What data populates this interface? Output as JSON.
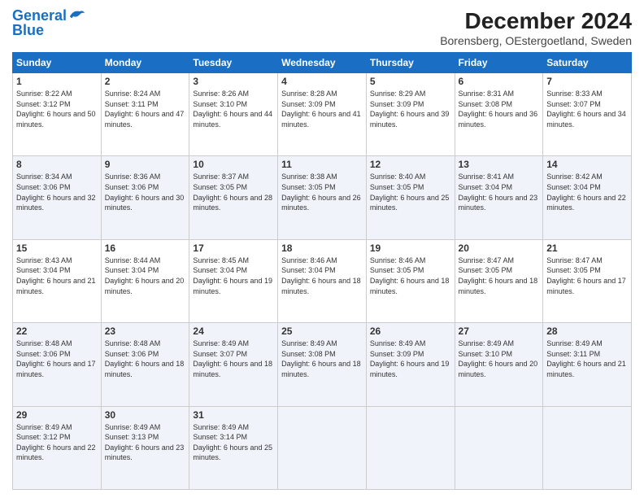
{
  "logo": {
    "line1": "General",
    "line2": "Blue"
  },
  "title": "December 2024",
  "subtitle": "Borensberg, OEstergoetland, Sweden",
  "header_days": [
    "Sunday",
    "Monday",
    "Tuesday",
    "Wednesday",
    "Thursday",
    "Friday",
    "Saturday"
  ],
  "weeks": [
    [
      {
        "day": "1",
        "sunrise": "Sunrise: 8:22 AM",
        "sunset": "Sunset: 3:12 PM",
        "daylight": "Daylight: 6 hours and 50 minutes."
      },
      {
        "day": "2",
        "sunrise": "Sunrise: 8:24 AM",
        "sunset": "Sunset: 3:11 PM",
        "daylight": "Daylight: 6 hours and 47 minutes."
      },
      {
        "day": "3",
        "sunrise": "Sunrise: 8:26 AM",
        "sunset": "Sunset: 3:10 PM",
        "daylight": "Daylight: 6 hours and 44 minutes."
      },
      {
        "day": "4",
        "sunrise": "Sunrise: 8:28 AM",
        "sunset": "Sunset: 3:09 PM",
        "daylight": "Daylight: 6 hours and 41 minutes."
      },
      {
        "day": "5",
        "sunrise": "Sunrise: 8:29 AM",
        "sunset": "Sunset: 3:09 PM",
        "daylight": "Daylight: 6 hours and 39 minutes."
      },
      {
        "day": "6",
        "sunrise": "Sunrise: 8:31 AM",
        "sunset": "Sunset: 3:08 PM",
        "daylight": "Daylight: 6 hours and 36 minutes."
      },
      {
        "day": "7",
        "sunrise": "Sunrise: 8:33 AM",
        "sunset": "Sunset: 3:07 PM",
        "daylight": "Daylight: 6 hours and 34 minutes."
      }
    ],
    [
      {
        "day": "8",
        "sunrise": "Sunrise: 8:34 AM",
        "sunset": "Sunset: 3:06 PM",
        "daylight": "Daylight: 6 hours and 32 minutes."
      },
      {
        "day": "9",
        "sunrise": "Sunrise: 8:36 AM",
        "sunset": "Sunset: 3:06 PM",
        "daylight": "Daylight: 6 hours and 30 minutes."
      },
      {
        "day": "10",
        "sunrise": "Sunrise: 8:37 AM",
        "sunset": "Sunset: 3:05 PM",
        "daylight": "Daylight: 6 hours and 28 minutes."
      },
      {
        "day": "11",
        "sunrise": "Sunrise: 8:38 AM",
        "sunset": "Sunset: 3:05 PM",
        "daylight": "Daylight: 6 hours and 26 minutes."
      },
      {
        "day": "12",
        "sunrise": "Sunrise: 8:40 AM",
        "sunset": "Sunset: 3:05 PM",
        "daylight": "Daylight: 6 hours and 25 minutes."
      },
      {
        "day": "13",
        "sunrise": "Sunrise: 8:41 AM",
        "sunset": "Sunset: 3:04 PM",
        "daylight": "Daylight: 6 hours and 23 minutes."
      },
      {
        "day": "14",
        "sunrise": "Sunrise: 8:42 AM",
        "sunset": "Sunset: 3:04 PM",
        "daylight": "Daylight: 6 hours and 22 minutes."
      }
    ],
    [
      {
        "day": "15",
        "sunrise": "Sunrise: 8:43 AM",
        "sunset": "Sunset: 3:04 PM",
        "daylight": "Daylight: 6 hours and 21 minutes."
      },
      {
        "day": "16",
        "sunrise": "Sunrise: 8:44 AM",
        "sunset": "Sunset: 3:04 PM",
        "daylight": "Daylight: 6 hours and 20 minutes."
      },
      {
        "day": "17",
        "sunrise": "Sunrise: 8:45 AM",
        "sunset": "Sunset: 3:04 PM",
        "daylight": "Daylight: 6 hours and 19 minutes."
      },
      {
        "day": "18",
        "sunrise": "Sunrise: 8:46 AM",
        "sunset": "Sunset: 3:04 PM",
        "daylight": "Daylight: 6 hours and 18 minutes."
      },
      {
        "day": "19",
        "sunrise": "Sunrise: 8:46 AM",
        "sunset": "Sunset: 3:05 PM",
        "daylight": "Daylight: 6 hours and 18 minutes."
      },
      {
        "day": "20",
        "sunrise": "Sunrise: 8:47 AM",
        "sunset": "Sunset: 3:05 PM",
        "daylight": "Daylight: 6 hours and 18 minutes."
      },
      {
        "day": "21",
        "sunrise": "Sunrise: 8:47 AM",
        "sunset": "Sunset: 3:05 PM",
        "daylight": "Daylight: 6 hours and 17 minutes."
      }
    ],
    [
      {
        "day": "22",
        "sunrise": "Sunrise: 8:48 AM",
        "sunset": "Sunset: 3:06 PM",
        "daylight": "Daylight: 6 hours and 17 minutes."
      },
      {
        "day": "23",
        "sunrise": "Sunrise: 8:48 AM",
        "sunset": "Sunset: 3:06 PM",
        "daylight": "Daylight: 6 hours and 18 minutes."
      },
      {
        "day": "24",
        "sunrise": "Sunrise: 8:49 AM",
        "sunset": "Sunset: 3:07 PM",
        "daylight": "Daylight: 6 hours and 18 minutes."
      },
      {
        "day": "25",
        "sunrise": "Sunrise: 8:49 AM",
        "sunset": "Sunset: 3:08 PM",
        "daylight": "Daylight: 6 hours and 18 minutes."
      },
      {
        "day": "26",
        "sunrise": "Sunrise: 8:49 AM",
        "sunset": "Sunset: 3:09 PM",
        "daylight": "Daylight: 6 hours and 19 minutes."
      },
      {
        "day": "27",
        "sunrise": "Sunrise: 8:49 AM",
        "sunset": "Sunset: 3:10 PM",
        "daylight": "Daylight: 6 hours and 20 minutes."
      },
      {
        "day": "28",
        "sunrise": "Sunrise: 8:49 AM",
        "sunset": "Sunset: 3:11 PM",
        "daylight": "Daylight: 6 hours and 21 minutes."
      }
    ],
    [
      {
        "day": "29",
        "sunrise": "Sunrise: 8:49 AM",
        "sunset": "Sunset: 3:12 PM",
        "daylight": "Daylight: 6 hours and 22 minutes."
      },
      {
        "day": "30",
        "sunrise": "Sunrise: 8:49 AM",
        "sunset": "Sunset: 3:13 PM",
        "daylight": "Daylight: 6 hours and 23 minutes."
      },
      {
        "day": "31",
        "sunrise": "Sunrise: 8:49 AM",
        "sunset": "Sunset: 3:14 PM",
        "daylight": "Daylight: 6 hours and 25 minutes."
      },
      null,
      null,
      null,
      null
    ]
  ]
}
